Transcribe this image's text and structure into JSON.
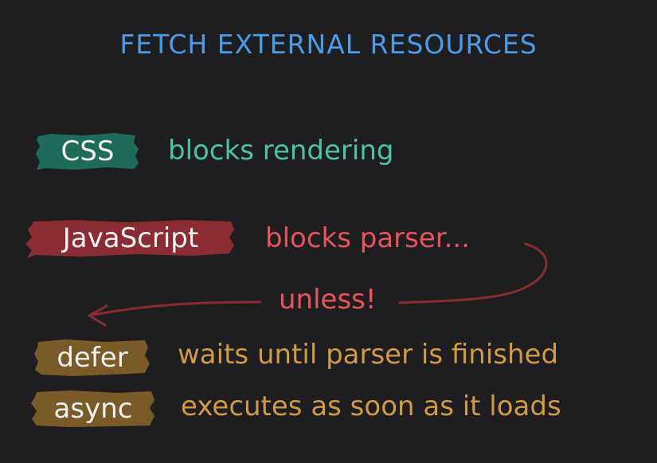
{
  "title": "FETCH EXTERNAL RESOURCES",
  "rows": {
    "css": {
      "tag": "CSS",
      "description": "blocks rendering",
      "tag_color": "#1f6b5a",
      "text_color": "#4cc4a0"
    },
    "js": {
      "tag": "JavaScript",
      "description": "blocks parser...",
      "tag_color": "#8b2b33",
      "text_color": "#e8545c"
    },
    "unless": {
      "text": "unless!",
      "arrow_color": "#8b2b33"
    },
    "defer": {
      "tag": "defer",
      "description": "waits until parser is finished",
      "tag_color": "#7a5a26",
      "text_color": "#d29a45"
    },
    "async": {
      "tag": "async",
      "description": "executes as soon as it loads",
      "tag_color": "#7a5a26",
      "text_color": "#d29a45"
    }
  },
  "colors": {
    "background": "#1e1e20",
    "title": "#4a9be8"
  }
}
